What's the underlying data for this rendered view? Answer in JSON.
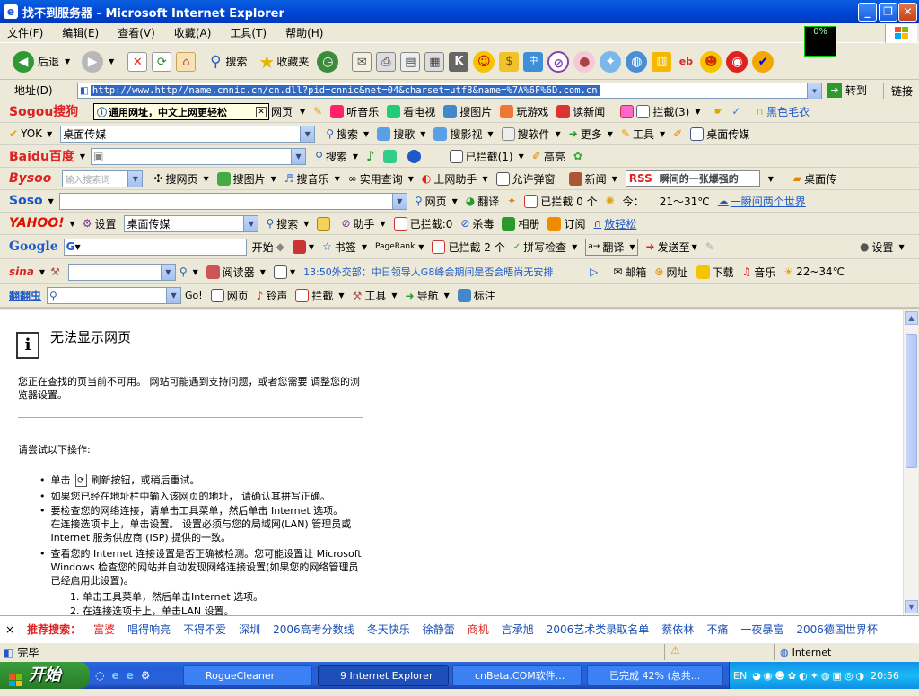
{
  "window": {
    "title": "找不到服务器 - Microsoft Internet Explorer",
    "min": "_",
    "max": "❐",
    "close": "✕"
  },
  "menu": [
    "文件(F)",
    "编辑(E)",
    "查看(V)",
    "收藏(A)",
    "工具(T)",
    "帮助(H)"
  ],
  "network_meter": "0%",
  "toolbar": {
    "back": "后退",
    "search": "搜索",
    "favorites": "收藏夹"
  },
  "address": {
    "label": "地址(D)",
    "url": "http://www.http//name.cnnic.cn/cn.dll?pid=cnnic&net=04&charset=utf8&name=%7A%6F%6D.com.cn",
    "go": "转到",
    "links": "链接"
  },
  "sogou": {
    "brand": "Sogou搜狗",
    "tooltip": "通用网址，中文上网更轻松",
    "web": "网页",
    "music": "听音乐",
    "tv": "看电视",
    "images": "搜图片",
    "games": "玩游戏",
    "news": "读新闻",
    "block": "拦截(3)",
    "blackwool": "黑色毛衣"
  },
  "yok": {
    "brand": "YOK",
    "combo": "桌面传媒",
    "search": "搜索",
    "song": "搜歌",
    "video": "搜影视",
    "software": "搜软件",
    "more": "更多",
    "tools": "工具",
    "desk": "桌面传媒"
  },
  "baidu": {
    "brand": "Baidu百度",
    "search": "搜索",
    "block": "已拦截(1)",
    "highlight": "高亮"
  },
  "bysoo": {
    "brand": "Bysoo",
    "placeholder": "输入搜索词",
    "web": "搜网页",
    "img": "搜图片",
    "music": "搜音乐",
    "query": "实用查询",
    "netassist": "上网助手",
    "popup": "允许弹窗",
    "news": "新闻",
    "rss": "RSS",
    "rss_text": "瞬间的一张爆强的",
    "desk": "桌面传"
  },
  "soso": {
    "brand": "Soso",
    "web": "网页",
    "translate": "翻译",
    "block": "已拦截 0 个",
    "today": "今：",
    "temp": "21～31℃",
    "link": "一瞬间两个世界"
  },
  "yahoo": {
    "brand": "YAHOO!",
    "settings": "设置",
    "combo": "桌面传媒",
    "search": "搜索",
    "assist": "助手",
    "block": "已拦截:0",
    "antivirus": "杀毒",
    "album": "相册",
    "subscribe": "订阅",
    "link": "放轻松"
  },
  "google": {
    "brand": "Google",
    "start": "开始",
    "bookmarks": "书签",
    "pagerank": "PageRank",
    "block": "已拦截 2 个",
    "spell": "拼写检查",
    "translate": "翻译",
    "sendto": "发送至",
    "settings": "设置"
  },
  "sina": {
    "brand": "sina",
    "reader": "阅读器",
    "news": "13:50外交部：中日领导人G8峰会期间是否会晤尚无安排",
    "mail": "邮箱",
    "site": "网址",
    "download": "下载",
    "music": "音乐",
    "temp": "22~34℃"
  },
  "lingyu": {
    "brand": "翻翻虫",
    "go": "Go!",
    "web": "网页",
    "ring": "铃声",
    "block": "拦截",
    "tools": "工具",
    "nav": "导航",
    "mark": "标注"
  },
  "page": {
    "heading": "无法显示网页",
    "p1": "您正在查找的页当前不可用。 网站可能遇到支持问题，或者您需要 调整您的浏览器设置。",
    "try": "请尝试以下操作:",
    "b1a": "单击",
    "b1b": "刷新按钮，或稍后重试。",
    "b2": "如果您已经在地址栏中输入该网页的地址， 请确认其拼写正确。",
    "b3": "要检查您的网络连接，请单击工具菜单，然后单击 Internet 选项。在连接选项卡上，单击设置。 设置必须与您的局域网(LAN) 管理员或 Internet 服务供应商 (ISP) 提供的一致。",
    "b4": "查看您的 Internet 连接设置是否正确被检测。您可能设置让 Microsoft Windows 检查您的网站并自动发现网络连接设置(如果您的网络管理员已经启用此设置)。",
    "s1": "1.   单击工具菜单，然后单击Internet 选项。",
    "s2": "2.   在连接选项卡上，单击LAN 设置。"
  },
  "recommend": {
    "close": "×",
    "label": "推荐搜索：",
    "items": [
      "富婆",
      "唱得响亮",
      "不得不爱",
      "深圳",
      "2006高考分数线",
      "冬天快乐",
      "徐静蕾",
      "商机",
      "言承旭",
      "2006艺术类录取名单",
      "蔡依林",
      "不痛",
      "一夜暴富",
      "2006德国世界杯"
    ]
  },
  "status": {
    "text": "完毕",
    "zone": "Internet"
  },
  "taskbar": {
    "start": "开始",
    "tasks": [
      "RogueCleaner",
      "9 Internet Explorer",
      "cnBeta.COM软件...",
      "已完成 42% (总共..."
    ],
    "lang": "EN",
    "clock": "20:56"
  }
}
